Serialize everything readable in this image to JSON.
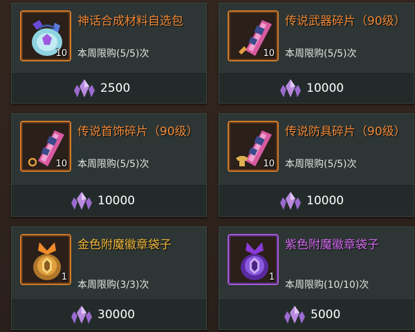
{
  "items": [
    {
      "title": "神话合成材料自选包",
      "limit": "本周限购(5/5)次",
      "quantity": "10",
      "price": "2500",
      "icon": "mythic-material-bag-icon",
      "rarity_color": "#d07a2c"
    },
    {
      "title": "传说武器碎片（90级）",
      "limit": "本周限购(5/5)次",
      "quantity": "10",
      "price": "10000",
      "icon": "legendary-weapon-shard-icon",
      "rarity_color": "#d07a2c"
    },
    {
      "title": "传说首饰碎片（90级）",
      "limit": "本周限购(5/5)次",
      "quantity": "10",
      "price": "10000",
      "icon": "legendary-accessory-shard-icon",
      "rarity_color": "#d07a2c"
    },
    {
      "title": "传说防具碎片（90级）",
      "limit": "本周限购(5/5)次",
      "quantity": "10",
      "price": "10000",
      "icon": "legendary-armor-shard-icon",
      "rarity_color": "#d07a2c"
    },
    {
      "title": "金色附魔徽章袋子",
      "limit": "本周限购(3/3)次",
      "quantity": "1",
      "price": "30000",
      "icon": "gold-enchant-badge-bag-icon",
      "rarity_color": "#d07a2c"
    },
    {
      "title": "紫色附魔徽章袋子",
      "limit": "本周限购(10/10)次",
      "quantity": "1",
      "price": "5000",
      "icon": "purple-enchant-badge-bag-icon",
      "rarity_color": "#a85ad8"
    }
  ],
  "currency_icon": "purple-crystal-icon"
}
